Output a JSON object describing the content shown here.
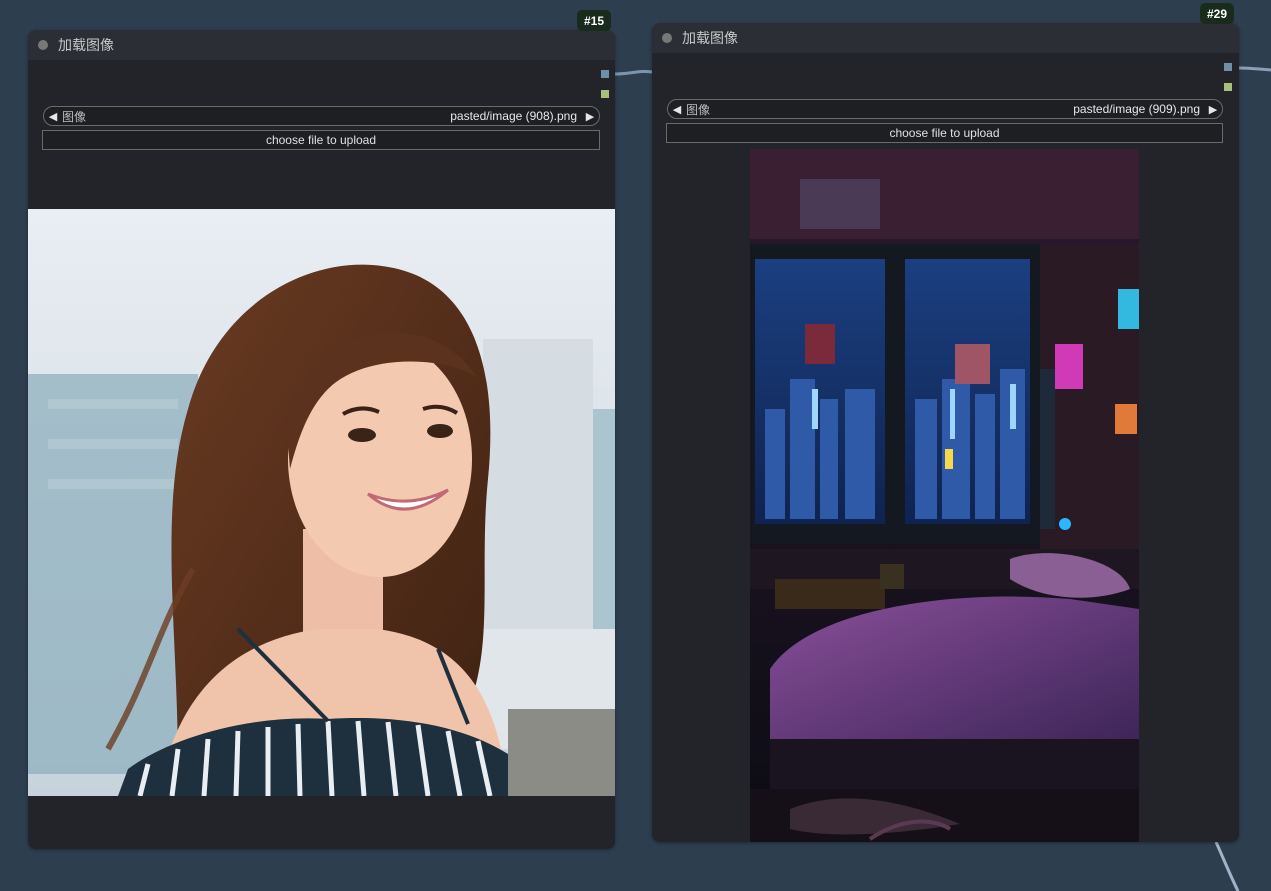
{
  "nodes": [
    {
      "id_badge": "#15",
      "title": "加载图像",
      "image_label": "图像",
      "image_value": "pasted/image (908).png",
      "upload_label": "choose file to upload"
    },
    {
      "id_badge": "#29",
      "title": "加载图像",
      "image_label": "图像",
      "image_value": "pasted/image (909).png",
      "upload_label": "choose file to upload"
    }
  ],
  "icons": {
    "prev": "◀",
    "next": "▶"
  },
  "colors": {
    "canvas_bg": "#2d3e4f",
    "node_body": "#222429",
    "node_header": "#2b2e35",
    "badge_bg": "#182b1c",
    "output_slot_image": "#6f8fa8",
    "output_slot_mask": "#a6bf7a"
  }
}
